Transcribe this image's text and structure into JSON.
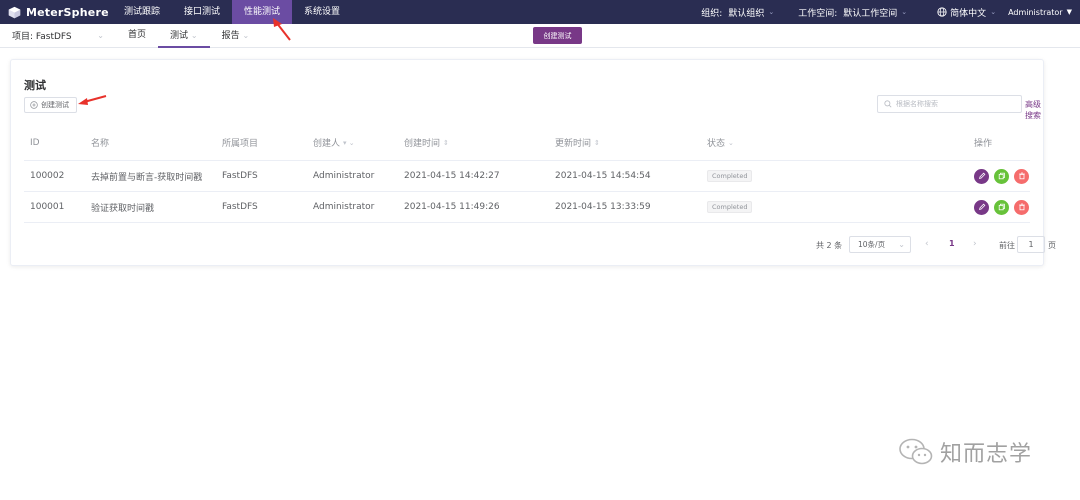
{
  "app": {
    "logo_text": "MeterSphere"
  },
  "topnav": {
    "items": [
      {
        "label": "测试跟踪"
      },
      {
        "label": "接口测试"
      },
      {
        "label": "性能测试",
        "active": true
      },
      {
        "label": "系统设置"
      }
    ]
  },
  "top_right": {
    "org_label": "组织:",
    "org_value": "默认组织",
    "workspace_label": "工作空间:",
    "workspace_value": "默认工作空间",
    "language": "简体中文",
    "user": "Administrator"
  },
  "subbar": {
    "project": "项目: FastDFS",
    "items": [
      {
        "label": "首页"
      },
      {
        "label": "测试",
        "active": true
      },
      {
        "label": "报告"
      }
    ],
    "create_button": "创建测试"
  },
  "card": {
    "title": "测试",
    "create_button": "创建测试",
    "search_placeholder": "根据名称搜索",
    "advanced_search": "高级搜索"
  },
  "table": {
    "columns": {
      "id": "ID",
      "name": "名称",
      "project": "所属项目",
      "creator": "创建人",
      "created": "创建时间",
      "updated": "更新时间",
      "status": "状态",
      "actions": "操作"
    },
    "rows": [
      {
        "id": "100002",
        "name": "去掉前置与断言-获取时间戳",
        "project": "FastDFS",
        "creator": "Administrator",
        "created": "2021-04-15 14:42:27",
        "updated": "2021-04-15 14:54:54",
        "status": "Completed"
      },
      {
        "id": "100001",
        "name": "验证获取时间戳",
        "project": "FastDFS",
        "creator": "Administrator",
        "created": "2021-04-15 11:49:26",
        "updated": "2021-04-15 13:33:59",
        "status": "Completed"
      }
    ]
  },
  "pagination": {
    "total": "共 2 条",
    "page_size": "10条/页",
    "current_page": "1",
    "goto_label": "前往",
    "goto_value": "1",
    "page_suffix": "页"
  },
  "watermark": {
    "text": "知而志学"
  },
  "colors": {
    "topbar_bg": "#2a2d52",
    "active_nav": "#6b4ca3",
    "primary": "#783887",
    "success": "#67c23a",
    "danger": "#f56c6c",
    "annotation": "#e8322b"
  },
  "icons": {
    "logo": "cube-logo-icon",
    "language": "globe-icon",
    "create": "plus-circle-icon",
    "search": "search-icon",
    "edit": "edit-icon",
    "copy": "copy-icon",
    "delete": "delete-icon"
  }
}
